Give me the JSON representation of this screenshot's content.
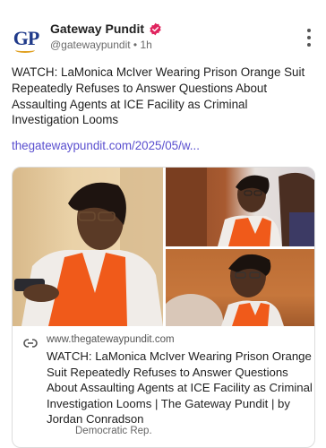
{
  "header": {
    "account_name": "Gateway Pundit",
    "handle": "@gatewaypundit",
    "separator": "•",
    "time": "1h",
    "avatar_text": "GP"
  },
  "post": {
    "text": "WATCH: LaMonica McIver Wearing Prison Orange Suit Repeatedly Refuses to Answer Questions About Assaulting Agents at ICE Facility as Criminal Investigation Looms",
    "link_text": "thegatewaypundit.com/2025/05/w..."
  },
  "card": {
    "domain": "www.thegatewaypundit.com",
    "title": "WATCH: LaMonica McIver Wearing Prison Orange Suit Repeatedly Refuses to Answer Questions About Assaulting Agents at ICE Facility as Criminal Investigation Looms | The Gateway Pundit | by Jordan Conradson",
    "tag": "Democratic Rep."
  },
  "icons": {
    "verified": "verified-badge-icon",
    "menu": "more-vertical-icon",
    "link": "link-icon"
  },
  "colors": {
    "verified": "#e0245e",
    "link": "#5a4fcf",
    "brand": "#1f3a8a",
    "orange": "#f05a1a"
  }
}
